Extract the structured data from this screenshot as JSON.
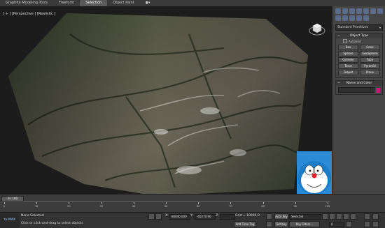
{
  "ribbon": {
    "tabs": [
      {
        "label": "Graphite Modeling Tools",
        "active": false
      },
      {
        "label": "Freeform",
        "active": false
      },
      {
        "label": "Selection",
        "active": true
      },
      {
        "label": "Object Paint",
        "active": false
      },
      {
        "label": "●▾",
        "active": false
      }
    ]
  },
  "viewport": {
    "label": "[ + ] [Perspective ] [Realistic ]"
  },
  "command_panel": {
    "category_dropdown": "Standard Primitives",
    "object_type_title": "Object Type",
    "autogrid_label": "AutoGrid",
    "primitives": [
      "Box",
      "Cone",
      "Sphere",
      "GeoSphere",
      "Cylinder",
      "Tube",
      "Torus",
      "Pyramid",
      "Teapot",
      "Plane"
    ],
    "name_color_title": "Name and Color",
    "swatch_color": "#c2197a"
  },
  "timeline": {
    "slider_label": "0 / 100",
    "ticks": [
      "0",
      "10",
      "20",
      "30",
      "40",
      "50",
      "60",
      "70",
      "80",
      "90",
      "100"
    ]
  },
  "statusbar": {
    "maxscript": "to MAX",
    "selection_status": "None Selected",
    "prompt": "Click or click-and-drag to select objects",
    "x_label": "X:",
    "x_value": "86840.000",
    "y_label": "Y:",
    "y_value": "-65270.90",
    "z_label": "Z:",
    "z_value": "",
    "grid": "Grid = 10000.0",
    "add_time_tag": "Add Time Tag",
    "auto_key": "Auto Key",
    "selected_dropdown": "Selected",
    "set_key": "Set Key",
    "key_filters": "Key Filters...",
    "frame_value": "0"
  }
}
